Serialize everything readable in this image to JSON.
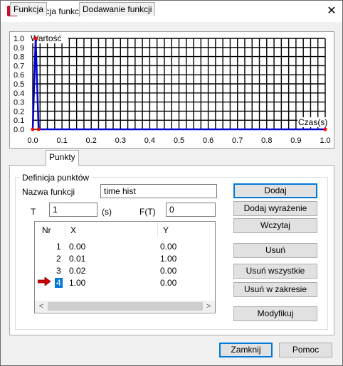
{
  "window": {
    "title": "Definicja funkcji czasu",
    "app_icon": "robot-logo-icon",
    "close_icon": "close-icon",
    "close_glyph": "✕"
  },
  "chart_data": {
    "type": "line",
    "title": "",
    "xlabel": "Czas(s)",
    "ylabel": "Wartość",
    "xlim": [
      0.0,
      1.0
    ],
    "ylim": [
      0.0,
      1.0
    ],
    "x_ticks": [
      "0.0",
      "0.1",
      "0.2",
      "0.3",
      "0.4",
      "0.5",
      "0.6",
      "0.7",
      "0.8",
      "0.9",
      "1.0"
    ],
    "y_ticks": [
      "0.0",
      "0.1",
      "0.2",
      "0.3",
      "0.4",
      "0.5",
      "0.6",
      "0.7",
      "0.8",
      "0.9",
      "1.0"
    ],
    "grid": true,
    "series": [
      {
        "x": [
          0.0,
          0.01,
          0.02,
          1.0
        ],
        "y": [
          0.0,
          1.0,
          0.0,
          0.0
        ],
        "color": "#0000cc",
        "point_color": "#ff0000"
      }
    ]
  },
  "tabs": [
    {
      "label": "Funkcja",
      "active": false
    },
    {
      "label": "Punkty",
      "active": true
    },
    {
      "label": "Dodawanie funkcji",
      "active": false
    }
  ],
  "group": {
    "legend": "Definicja punktów",
    "name_label": "Nazwa funkcji",
    "name_value": "time hist",
    "t_label": "T",
    "t_value": "1",
    "t_unit": "(s)",
    "ft_label": "F(T)",
    "ft_value": "0"
  },
  "table": {
    "columns": [
      "Nr",
      "X",
      "Y"
    ],
    "rows": [
      {
        "nr": "1",
        "x": "0.00",
        "y": "0.00"
      },
      {
        "nr": "2",
        "x": "0.01",
        "y": "1.00"
      },
      {
        "nr": "3",
        "x": "0.02",
        "y": "0.00"
      },
      {
        "nr": "4",
        "x": "1.00",
        "y": "0.00"
      }
    ],
    "selected_row": 4,
    "arrow_color": "#d40000"
  },
  "buttons": {
    "dodaj": "Dodaj",
    "dodaj_wyrazenie": "Dodaj wyrażenie",
    "wczytaj": "Wczytaj",
    "usun": "Usuń",
    "usun_wszystkie": "Usuń wszystkie",
    "usun_w_zakresie": "Usuń w zakresie",
    "modyfikuj": "Modyfikuj",
    "zamknij": "Zamknij",
    "pomoc": "Pomoc"
  },
  "scrollbar": {
    "left_glyph": "<",
    "right_glyph": ">"
  }
}
